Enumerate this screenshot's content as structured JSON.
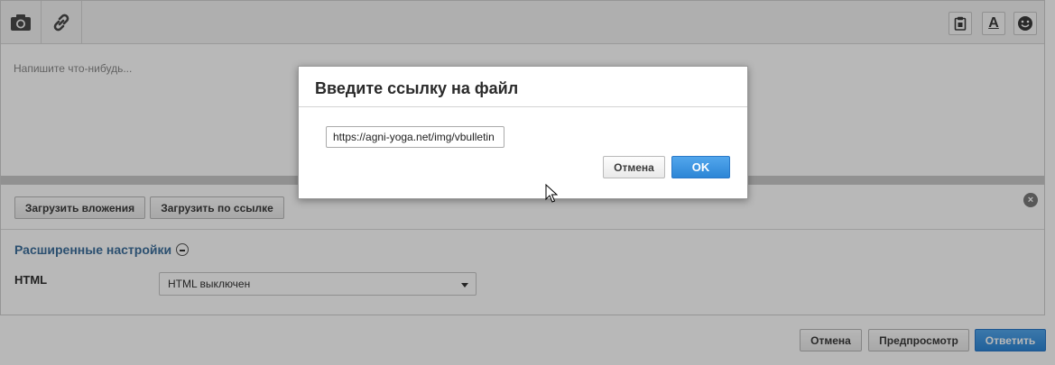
{
  "editor": {
    "placeholder": "Напишите что-нибудь...",
    "toolbar_left": [
      {
        "icon": "camera-icon"
      },
      {
        "icon": "link-icon"
      }
    ],
    "toolbar_right": [
      {
        "icon": "clipboard-icon"
      },
      {
        "icon": "font-color-icon",
        "glyph": "A"
      },
      {
        "icon": "smiley-icon"
      }
    ]
  },
  "attachments": {
    "upload_label": "Загрузить вложения",
    "upload_url_label": "Загрузить по ссылке",
    "close_glyph": "×"
  },
  "advanced": {
    "title": "Расширенные настройки",
    "html_label": "HTML",
    "html_select_value": "HTML выключен"
  },
  "footer": {
    "cancel_label": "Отмена",
    "preview_label": "Предпросмотр",
    "reply_label": "Ответить"
  },
  "dialog": {
    "title": "Введите ссылку на файл",
    "url_value": "https://agni-yoga.net/img/vbulletin",
    "cancel_label": "Отмена",
    "ok_label": "OK"
  },
  "colors": {
    "accent_blue": "#2d86d6",
    "link_blue": "#3e6f9c"
  }
}
